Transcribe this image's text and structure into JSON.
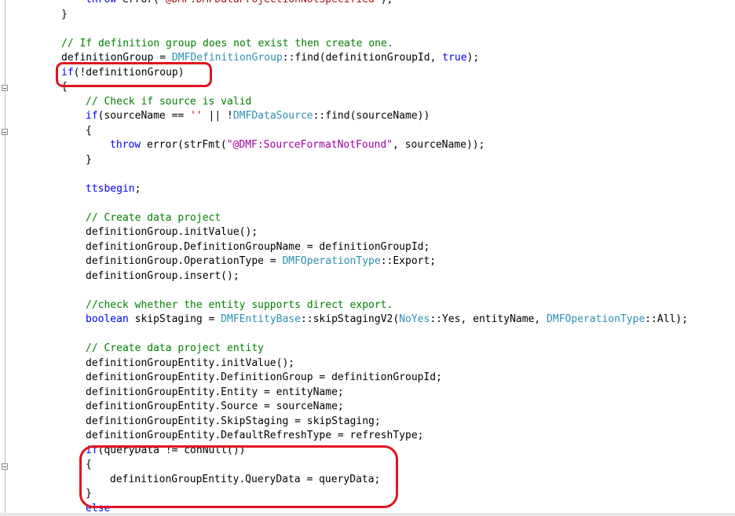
{
  "editor": {
    "lines": [
      {
        "indent": 2,
        "tokens": [
          {
            "t": "throw",
            "c": "kw"
          },
          {
            "t": " error(",
            "c": ""
          },
          {
            "t": "\"@DMF:DMFDataProjectionNotSpecified\"",
            "c": "str"
          },
          {
            "t": ");",
            "c": ""
          }
        ]
      },
      {
        "indent": 1,
        "tokens": [
          {
            "t": "}",
            "c": ""
          }
        ]
      },
      {
        "indent": 0,
        "tokens": []
      },
      {
        "indent": 1,
        "tokens": [
          {
            "t": "// If definition group does not exist then create one.",
            "c": "cm"
          }
        ]
      },
      {
        "indent": 1,
        "tokens": [
          {
            "t": "definitionGroup = ",
            "c": ""
          },
          {
            "t": "DMFDefinitionGroup",
            "c": "ty"
          },
          {
            "t": "::find(definitionGroupId, ",
            "c": ""
          },
          {
            "t": "true",
            "c": "kw"
          },
          {
            "t": ");",
            "c": ""
          }
        ]
      },
      {
        "indent": 1,
        "tokens": [
          {
            "t": "if",
            "c": "kw"
          },
          {
            "t": "(!definitionGroup)",
            "c": ""
          }
        ]
      },
      {
        "indent": 1,
        "tokens": [
          {
            "t": "{",
            "c": ""
          }
        ]
      },
      {
        "indent": 2,
        "tokens": [
          {
            "t": "// Check if source is valid",
            "c": "cm"
          }
        ]
      },
      {
        "indent": 2,
        "tokens": [
          {
            "t": "if",
            "c": "kw"
          },
          {
            "t": "(sourceName == ",
            "c": ""
          },
          {
            "t": "''",
            "c": "str"
          },
          {
            "t": " || !",
            "c": ""
          },
          {
            "t": "DMFDataSource",
            "c": "ty"
          },
          {
            "t": "::find(sourceName))",
            "c": ""
          }
        ]
      },
      {
        "indent": 2,
        "tokens": [
          {
            "t": "{",
            "c": ""
          }
        ]
      },
      {
        "indent": 3,
        "tokens": [
          {
            "t": "throw",
            "c": "kw"
          },
          {
            "t": " error(strFmt(",
            "c": ""
          },
          {
            "t": "\"@DMF:SourceFormatNotFound\"",
            "c": "lab"
          },
          {
            "t": ", sourceName));",
            "c": ""
          }
        ]
      },
      {
        "indent": 2,
        "tokens": [
          {
            "t": "}",
            "c": ""
          }
        ]
      },
      {
        "indent": 0,
        "tokens": []
      },
      {
        "indent": 2,
        "tokens": [
          {
            "t": "ttsbegin",
            "c": "kw"
          },
          {
            "t": ";",
            "c": ""
          }
        ]
      },
      {
        "indent": 0,
        "tokens": []
      },
      {
        "indent": 2,
        "tokens": [
          {
            "t": "// Create data project",
            "c": "cm"
          }
        ]
      },
      {
        "indent": 2,
        "tokens": [
          {
            "t": "definitionGroup.initValue();",
            "c": ""
          }
        ]
      },
      {
        "indent": 2,
        "tokens": [
          {
            "t": "definitionGroup.DefinitionGroupName = definitionGroupId;",
            "c": ""
          }
        ]
      },
      {
        "indent": 2,
        "tokens": [
          {
            "t": "definitionGroup.OperationType = ",
            "c": ""
          },
          {
            "t": "DMFOperationType",
            "c": "ty"
          },
          {
            "t": "::Export;",
            "c": ""
          }
        ]
      },
      {
        "indent": 2,
        "tokens": [
          {
            "t": "definitionGroup.insert();",
            "c": ""
          }
        ]
      },
      {
        "indent": 0,
        "tokens": []
      },
      {
        "indent": 2,
        "tokens": [
          {
            "t": "//check whether the entity supports direct export.",
            "c": "cm"
          }
        ]
      },
      {
        "indent": 2,
        "tokens": [
          {
            "t": "boolean",
            "c": "kw"
          },
          {
            "t": " skipStaging = ",
            "c": ""
          },
          {
            "t": "DMFEntityBase",
            "c": "ty"
          },
          {
            "t": "::skipStagingV2(",
            "c": ""
          },
          {
            "t": "NoYes",
            "c": "ty"
          },
          {
            "t": "::Yes, entityName, ",
            "c": ""
          },
          {
            "t": "DMFOperationType",
            "c": "ty"
          },
          {
            "t": "::All);",
            "c": ""
          }
        ]
      },
      {
        "indent": 0,
        "tokens": []
      },
      {
        "indent": 2,
        "tokens": [
          {
            "t": "// Create data project entity",
            "c": "cm"
          }
        ]
      },
      {
        "indent": 2,
        "tokens": [
          {
            "t": "definitionGroupEntity.initValue();",
            "c": ""
          }
        ]
      },
      {
        "indent": 2,
        "tokens": [
          {
            "t": "definitionGroupEntity.DefinitionGroup = definitionGroupId;",
            "c": ""
          }
        ]
      },
      {
        "indent": 2,
        "tokens": [
          {
            "t": "definitionGroupEntity.Entity = entityName;",
            "c": ""
          }
        ]
      },
      {
        "indent": 2,
        "tokens": [
          {
            "t": "definitionGroupEntity.Source = sourceName;",
            "c": ""
          }
        ]
      },
      {
        "indent": 2,
        "tokens": [
          {
            "t": "definitionGroupEntity.SkipStaging = skipStaging;",
            "c": ""
          }
        ]
      },
      {
        "indent": 2,
        "tokens": [
          {
            "t": "definitionGroupEntity.DefaultRefreshType = refreshType;",
            "c": ""
          }
        ]
      },
      {
        "indent": 2,
        "tokens": [
          {
            "t": "if",
            "c": "kw"
          },
          {
            "t": "(queryData != conNull())",
            "c": ""
          }
        ]
      },
      {
        "indent": 2,
        "tokens": [
          {
            "t": "{",
            "c": ""
          }
        ]
      },
      {
        "indent": 3,
        "tokens": [
          {
            "t": "definitionGroupEntity.QueryData = queryData;",
            "c": ""
          }
        ]
      },
      {
        "indent": 2,
        "tokens": [
          {
            "t": "}",
            "c": ""
          }
        ]
      },
      {
        "indent": 2,
        "tokens": [
          {
            "t": "else",
            "c": "kw"
          }
        ]
      }
    ]
  },
  "colors": {
    "keyword": "#0000ff",
    "comment": "#008000",
    "type": "#2b91af",
    "label": "#a000a0",
    "highlight": "#e0141e"
  }
}
